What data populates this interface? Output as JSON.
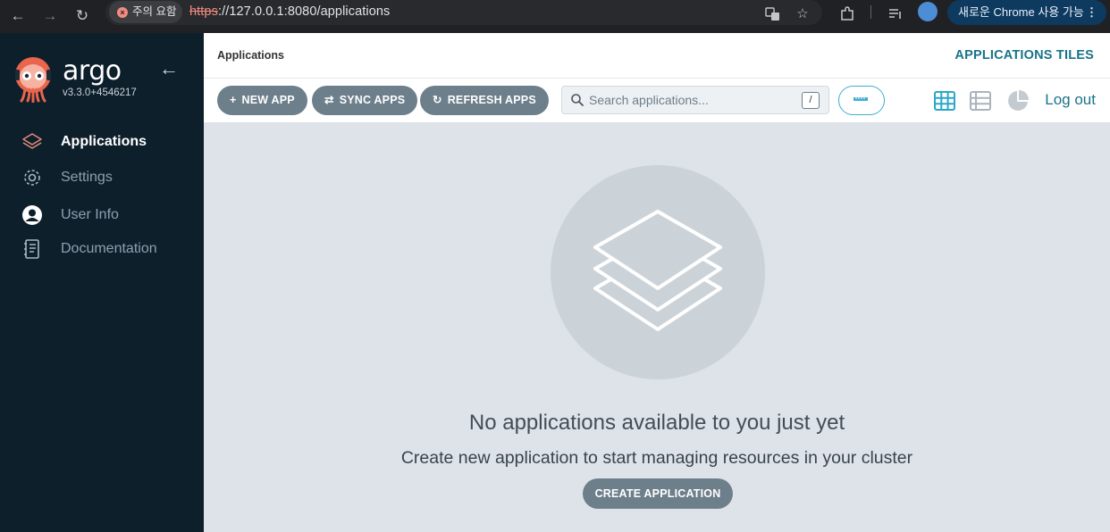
{
  "browser": {
    "security_label": "주의 요함",
    "url_scheme": "https",
    "url_rest": "://127.0.0.1:8080/applications",
    "update_label": "새로운 Chrome 사용 가능",
    "icons": [
      "back-icon",
      "forward-icon",
      "reload-icon",
      "translate-icon",
      "star-icon",
      "extensions-icon",
      "reading-list-icon",
      "profile-avatar",
      "more-icon"
    ]
  },
  "sidebar": {
    "brand": "argo",
    "version": "v3.3.0+4546217",
    "items": [
      {
        "label": "Applications",
        "icon": "layers-icon",
        "active": true
      },
      {
        "label": "Settings",
        "icon": "gear-icon",
        "active": false
      },
      {
        "label": "User Info",
        "icon": "user-icon",
        "active": false
      },
      {
        "label": "Documentation",
        "icon": "book-icon",
        "active": false
      }
    ]
  },
  "header": {
    "page_title": "Applications",
    "view_title": "APPLICATIONS TILES"
  },
  "toolbar": {
    "new_app": "NEW APP",
    "sync_apps": "SYNC APPS",
    "refresh_apps": "REFRESH APPS",
    "search_placeholder": "Search applications...",
    "search_shortcut": "/",
    "logout": "Log out"
  },
  "empty_state": {
    "title": "No applications available to you just yet",
    "subtitle": "Create new application to start managing resources in your cluster",
    "button": "CREATE APPLICATION"
  },
  "colors": {
    "sidebar_bg": "#0e1f2c",
    "accent": "#18738a",
    "button_gray": "#6d7f8b",
    "content_bg": "#dee3ea"
  }
}
